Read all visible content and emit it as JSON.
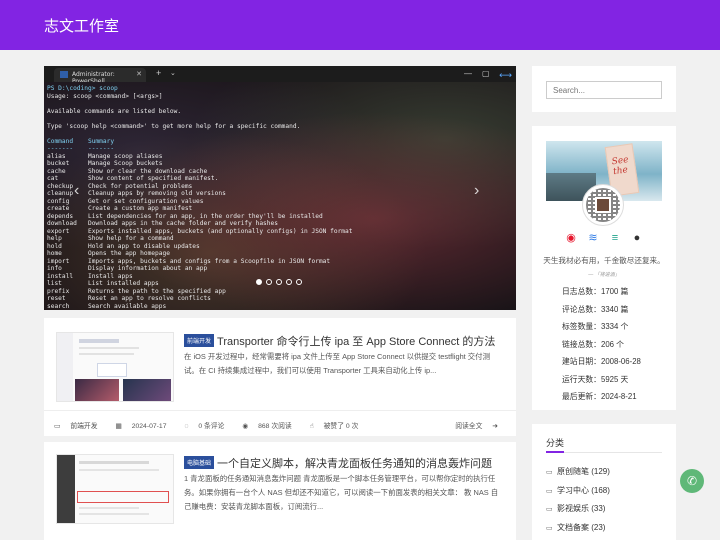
{
  "site": {
    "title": "志文工作室"
  },
  "slider": {
    "tab_title": "Administrator: PowerShell",
    "terminal_lines": [
      "PS D:\\coding> scoop",
      "Usage: scoop <command> [<args>]",
      "",
      "Available commands are listed below.",
      "",
      "Type 'scoop help <command>' to get more help for a specific command.",
      "",
      "Command    Summary",
      "-------    -------",
      "alias      Manage scoop aliases",
      "bucket     Manage Scoop buckets",
      "cache      Show or clear the download cache",
      "cat        Show content of specified manifest.",
      "checkup    Check for potential problems",
      "cleanup    Cleanup apps by removing old versions",
      "config     Get or set configuration values",
      "create     Create a custom app manifest",
      "depends    List dependencies for an app, in the order they'll be installed",
      "download   Download apps in the cache folder and verify hashes",
      "export     Exports installed apps, buckets (and optionally configs) in JSON format",
      "help       Show help for a command",
      "hold       Hold an app to disable updates",
      "home       Opens the app homepage",
      "import     Imports apps, buckets and configs from a Scoopfile in JSON format",
      "info       Display information about an app",
      "install    Install apps",
      "list       List installed apps",
      "prefix     Returns the path to the specified app",
      "reset      Reset an app to resolve conflicts",
      "search     Search available apps"
    ],
    "slide_count": 5,
    "active_slide": 1
  },
  "posts": [
    {
      "category": "前端开发",
      "title": "Transporter 命令行上传 ipa 至 App Store Connect 的方法",
      "excerpt": "在 iOS 开发过程中，经常需要将 ipa 文件上传至 App Store Connect 以供提交 testflight 交付测试。在 CI 持续集成过程中，我们可以使用 Transporter 工具来自动化上传 ip...",
      "meta": {
        "category": "前端开发",
        "date": "2024-07-17",
        "comments": "0 条评论",
        "views": "868 次阅读",
        "likes": "被赞了 0 次",
        "more": "阅读全文"
      }
    },
    {
      "category": "电脑基础",
      "title": "一个自定义脚本，解决青龙面板任务通知的消息轰炸问题",
      "excerpt": "1 青龙面板的任务通知消息轰炸问题 青龙面板是一个脚本任务管理平台，可以帮你定时的执行任务。如果你拥有一台个人 NAS 但却还不知道它，可以阅读一下前面发表的相关文章： 教 NAS 自己赚电费：安装青龙脚本面板，订阅流行..."
    }
  ],
  "sidebar": {
    "search_placeholder": "Search...",
    "banner_text": "See the",
    "motto": "天生我材必有用，千金散尽还复来。",
    "motto_source": "— 「将进酒」",
    "stats": [
      "日志总数：1700 篇",
      "评论总数：3340 篇",
      "标签数量：3334 个",
      "链接总数：206 个",
      "建站日期：2008-06-28",
      "运行天数：5925 天",
      "最后更新：2024-8-21"
    ],
    "categories_title": "分类",
    "categories": [
      "原创随笔 (129)",
      "学习中心 (168)",
      "影视娱乐 (33)",
      "文档备案 (23)",
      "热点关注 (92)"
    ]
  },
  "colors": {
    "brand": "#8224e3",
    "badge": "#2b4f9c",
    "chat": "#5fb878"
  }
}
